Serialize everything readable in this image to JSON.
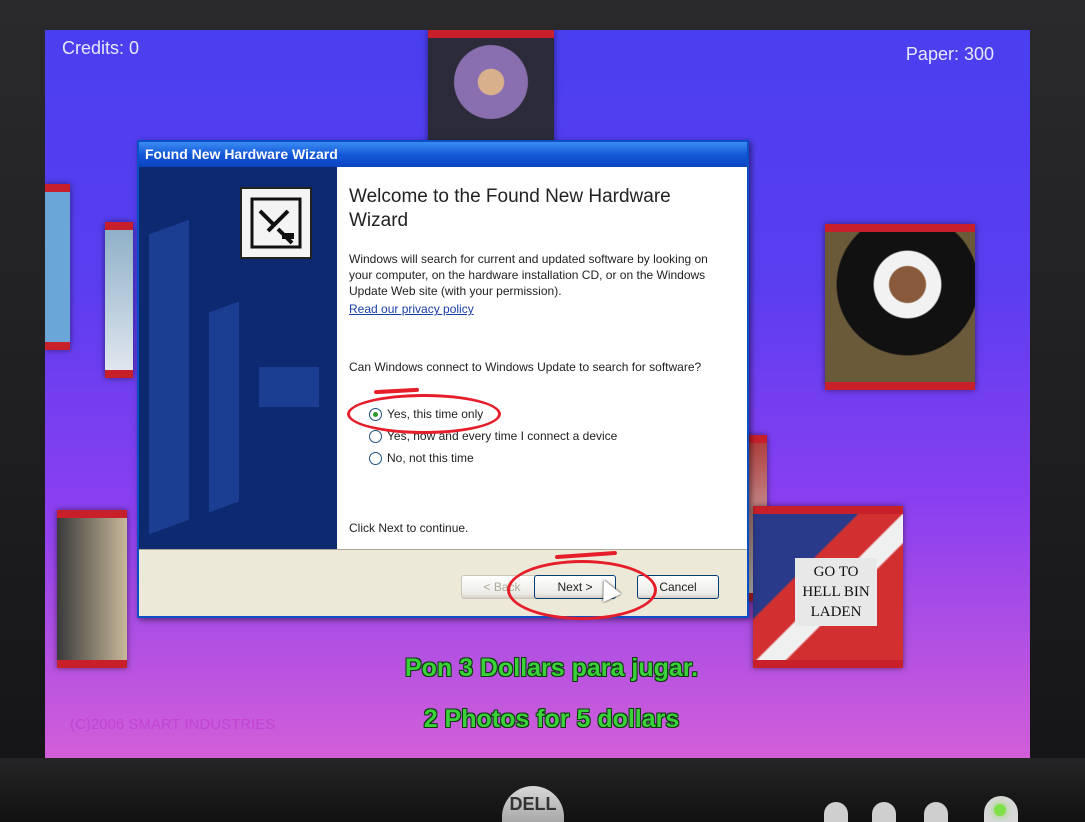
{
  "kiosk": {
    "credits": "Credits: 0",
    "paper": "Paper: 300",
    "promo_line1": "Pon 3 Dollars para jugar.",
    "promo_line2": "2 Photos for 5 dollars",
    "copyright": "(C)2006 SMART INDUSTRIES",
    "photo_sign_text": "GO TO HELL BIN LADEN"
  },
  "dialog": {
    "title": "Found New Hardware Wizard",
    "heading": "Welcome to the Found New Hardware Wizard",
    "description": "Windows will search for current and updated software by looking on your computer, on the hardware installation CD, or on the Windows Update Web site (with your permission).",
    "privacy_link": "Read our privacy policy",
    "question": "Can Windows connect to Windows Update to search for software?",
    "options": [
      {
        "label": "Yes, this time only",
        "selected": true
      },
      {
        "label": "Yes, now and every time I connect a device",
        "selected": false
      },
      {
        "label": "No, not this time",
        "selected": false
      }
    ],
    "footer_text": "Click Next to continue.",
    "buttons": {
      "back": "< Back",
      "next": "Next >",
      "cancel": "Cancel"
    }
  },
  "monitor": {
    "brand": "DELL"
  },
  "colors": {
    "annotation": "#e61e2a",
    "tile_border": "#c8202a",
    "promo_text": "#3bd13b"
  }
}
